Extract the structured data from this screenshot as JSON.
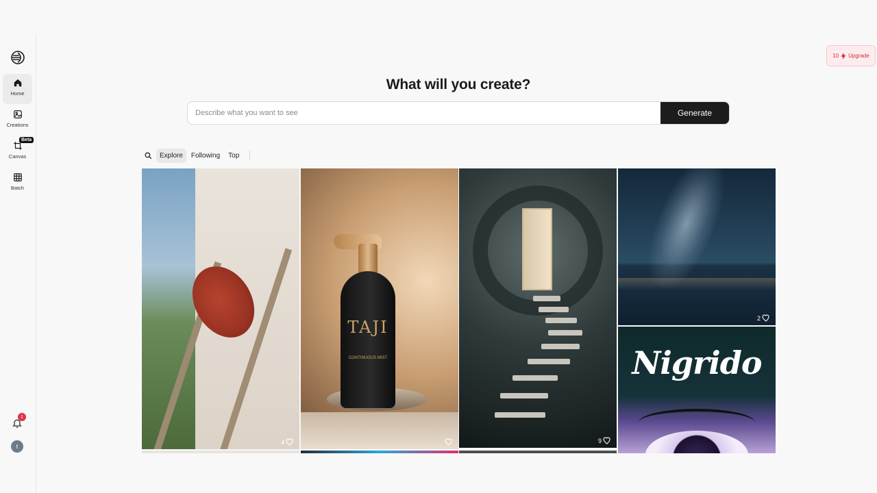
{
  "sidebar": {
    "items": [
      {
        "label": "Home",
        "icon": "home-icon",
        "active": true
      },
      {
        "label": "Creations",
        "icon": "image-icon",
        "active": false
      },
      {
        "label": "Canvas",
        "icon": "canvas-icon",
        "active": false,
        "badge": "Beta"
      },
      {
        "label": "Batch",
        "icon": "grid-icon",
        "active": false
      }
    ],
    "notifications_count": "1",
    "avatar_initial": "t"
  },
  "upgrade": {
    "credits": "10",
    "label": "Upgrade"
  },
  "hero": {
    "title": "What will you create?",
    "placeholder": "Describe what you want to see",
    "generate_label": "Generate"
  },
  "tabs": [
    "Explore",
    "Following",
    "Top"
  ],
  "feed": {
    "tiles": [
      {
        "subject": "red hat on wooden ladder",
        "likes": "4"
      },
      {
        "subject": "perfume mist bottle",
        "likes": "",
        "brand": "TAJI",
        "sub": "CONTINUOUS MIST"
      },
      {
        "subject": "door with spiral stairs",
        "likes": "9"
      },
      {
        "subject": "milky way over sea",
        "likes": "2"
      },
      {
        "subject": "Nigrido eye artwork",
        "likes": "",
        "title": "Nigrido"
      }
    ]
  },
  "colors": {
    "accent": "#1c1c1c",
    "upgrade_text": "#d42a3a",
    "badge": "#e5304a"
  }
}
